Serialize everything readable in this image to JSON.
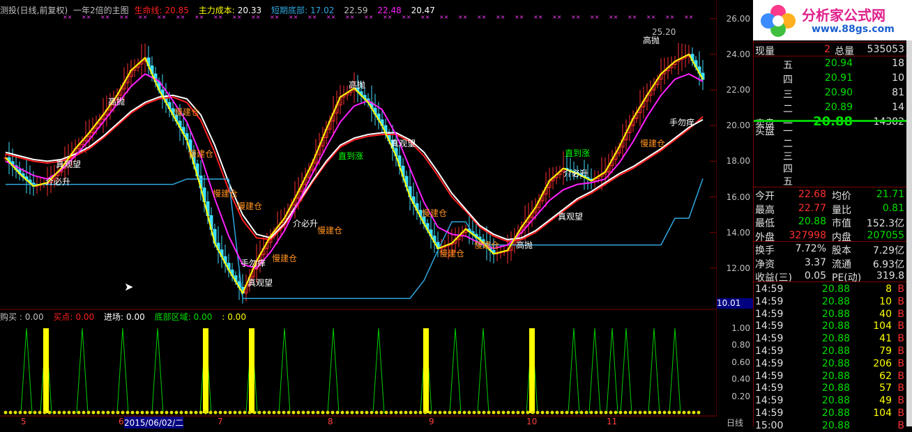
{
  "legend_main": {
    "prefix": "测投(日线,前复权)",
    "indicator": "一年2倍的主图",
    "life_line_label": "生命线:",
    "life_line_value": "20.85",
    "main_cost_label": "主力成本:",
    "main_cost_value": "20.33",
    "short_bottom_label": "短期底部:",
    "short_bottom_value": "17.02",
    "v4": "22.59",
    "v5": "22.48",
    "v6": "20.47"
  },
  "legend_sub": {
    "buy_label": "购买 :",
    "buy_value": "0.00",
    "buy_point_label": "买点:",
    "buy_point_value": "0.00",
    "entry_label": "进场:",
    "entry_value": "0.00",
    "bottom_zone_label": "底部区域:",
    "bottom_zone_value": "0.00",
    "last_label": ":",
    "last_value": "0.00"
  },
  "price_axis": [
    "26.00",
    "24.00",
    "22.00",
    "20.00",
    "18.00",
    "16.00",
    "14.00",
    "12.00"
  ],
  "price_axis_highlight": "10.01",
  "sub_axis": [
    "1.00",
    "0.80",
    "0.60",
    "0.40",
    "0.20"
  ],
  "date_axis": [
    "5",
    "6",
    "2015/06/02/二",
    "7",
    "8",
    "9",
    "10",
    "11"
  ],
  "period_label": "日线",
  "annotations": [
    {
      "text": "高抛",
      "color": "#ffffff"
    },
    {
      "text": "真观望",
      "color": "#ffffff"
    },
    {
      "text": "介必升",
      "color": "#ffffff"
    },
    {
      "text": "慢建仓",
      "color": "#ff9020"
    },
    {
      "text": "慢建仓",
      "color": "#ff9020"
    },
    {
      "text": "慢建仓",
      "color": "#ff9020"
    },
    {
      "text": "慢建仓",
      "color": "#ff9020"
    },
    {
      "text": "手勿痒",
      "color": "#ffffff"
    },
    {
      "text": "真观望",
      "color": "#ffffff"
    },
    {
      "text": "介必升",
      "color": "#ffffff"
    },
    {
      "text": "慢建仓",
      "color": "#ff9020"
    },
    {
      "text": "直到涨",
      "color": "#00ff00"
    },
    {
      "text": "高抛",
      "color": "#ffffff"
    },
    {
      "text": "慢建仓",
      "color": "#ff9020"
    },
    {
      "text": "真观望",
      "color": "#ffffff"
    },
    {
      "text": "慢建仓",
      "color": "#ff9020"
    },
    {
      "text": "慢建仓",
      "color": "#ff9020"
    },
    {
      "text": "慢建仓",
      "color": "#ff9020"
    },
    {
      "text": "高抛",
      "color": "#ffffff"
    },
    {
      "text": "直到涨",
      "color": "#00ff00"
    },
    {
      "text": "介必升",
      "color": "#ffffff"
    },
    {
      "text": "真观望",
      "color": "#ffffff"
    },
    {
      "text": "慢建仓",
      "color": "#ff9020"
    },
    {
      "text": "手勿痒",
      "color": "#ffffff"
    },
    {
      "text": "25.20",
      "color": "#c0c0c0"
    },
    {
      "text": "高抛",
      "color": "#ffffff"
    }
  ],
  "panel": {
    "price_top": "20.8",
    "volume_row": {
      "label": "现量",
      "value": "2",
      "label2": "总量",
      "value2": "535053"
    },
    "asks": [
      {
        "label": "五",
        "price": "20.94",
        "vol": "18"
      },
      {
        "label": "四",
        "price": "20.91",
        "vol": "10"
      },
      {
        "label": "三",
        "price": "20.90",
        "vol": "81"
      },
      {
        "label": "二",
        "price": "20.89",
        "vol": "14"
      },
      {
        "label": "一",
        "price": "20.88",
        "vol": "14382"
      }
    ],
    "ask_title": "卖盘",
    "bid_title": "买盘",
    "bids": [
      "一",
      "二",
      "三",
      "四",
      "五"
    ],
    "stats": [
      {
        "l1": "今开",
        "v1": "22.68",
        "c1": "red",
        "l2": "均价",
        "v2": "21.71",
        "c2": "green"
      },
      {
        "l1": "最高",
        "v1": "22.77",
        "c1": "red",
        "l2": "量比",
        "v2": "0.81",
        "c2": "green"
      },
      {
        "l1": "最低",
        "v1": "20.88",
        "c1": "green",
        "l2": "市值",
        "v2": "152.3亿",
        "c2": "white"
      },
      {
        "l1": "外盘",
        "v1": "327998",
        "c1": "red",
        "l2": "内盘",
        "v2": "207055",
        "c2": "green"
      },
      {
        "l1": "换手",
        "v1": "7.72%",
        "c1": "white",
        "l2": "股本",
        "v2": "7.29亿",
        "c2": "white"
      },
      {
        "l1": "净资",
        "v1": "3.37",
        "c1": "white",
        "l2": "流通",
        "v2": "6.93亿",
        "c2": "white"
      },
      {
        "l1": "收益(三)",
        "v1": "0.05",
        "c1": "white",
        "l2": "PE(动)",
        "v2": "319.8",
        "c2": "white"
      }
    ],
    "ticks": [
      {
        "t": "14:59",
        "p": "20.88",
        "v": "8",
        "s": "B"
      },
      {
        "t": "14:59",
        "p": "20.88",
        "v": "10",
        "s": "B"
      },
      {
        "t": "14:59",
        "p": "20.88",
        "v": "40",
        "s": "B"
      },
      {
        "t": "14:59",
        "p": "20.88",
        "v": "104",
        "s": "B"
      },
      {
        "t": "14:59",
        "p": "20.88",
        "v": "41",
        "s": "B"
      },
      {
        "t": "14:59",
        "p": "20.88",
        "v": "79",
        "s": "B"
      },
      {
        "t": "14:59",
        "p": "20.88",
        "v": "206",
        "s": "B"
      },
      {
        "t": "14:59",
        "p": "20.88",
        "v": "62",
        "s": "B"
      },
      {
        "t": "14:59",
        "p": "20.88",
        "v": "57",
        "s": "B"
      },
      {
        "t": "14:59",
        "p": "20.88",
        "v": "49",
        "s": "B"
      },
      {
        "t": "14:59",
        "p": "20.88",
        "v": "104",
        "s": "B"
      },
      {
        "t": "15:00",
        "p": "20.88",
        "v": "",
        "s": "B"
      }
    ]
  },
  "logo": {
    "title": "分析家公式网",
    "url": "www.88gs.com"
  },
  "chart_data": [
    {
      "type": "line",
      "title": "一年2倍的主图",
      "xlabel": "",
      "ylabel": "",
      "ylim": [
        10,
        26.5
      ],
      "x": [
        0,
        20,
        40,
        60,
        80,
        100,
        120,
        140,
        160,
        180,
        200,
        220,
        240,
        260,
        280,
        300,
        320,
        340,
        360,
        380,
        400,
        420,
        440,
        460,
        480,
        500,
        520,
        540,
        560,
        580,
        600,
        620,
        640,
        660,
        680,
        700,
        720,
        740,
        760,
        780,
        800,
        820,
        840,
        860,
        880,
        900,
        920,
        940,
        960,
        980,
        1000
      ],
      "series": [
        {
          "name": "生命线",
          "color": "#ff2020",
          "values": [
            18.4,
            18.2,
            18.0,
            17.9,
            18.0,
            18.3,
            18.7,
            19.3,
            20.0,
            20.7,
            21.2,
            21.5,
            21.6,
            21.3,
            20.3,
            18.5,
            16.4,
            14.7,
            13.7,
            13.6,
            14.4,
            15.6,
            16.8,
            17.9,
            18.8,
            19.2,
            19.4,
            19.5,
            19.5,
            19.1,
            18.3,
            17.2,
            16.0,
            15.2,
            14.3,
            13.8,
            13.5,
            13.6,
            14.0,
            14.6,
            15.2,
            15.8,
            16.2,
            16.7,
            17.2,
            17.6,
            18.1,
            18.6,
            19.2,
            19.8,
            20.5
          ]
        },
        {
          "name": "主力成本",
          "color": "#ffffff",
          "values": [
            18.5,
            18.3,
            18.1,
            18.0,
            18.1,
            18.4,
            18.8,
            19.4,
            20.1,
            20.8,
            21.3,
            21.6,
            21.7,
            21.5,
            20.6,
            18.9,
            16.8,
            15.0,
            13.9,
            13.7,
            14.5,
            15.7,
            16.9,
            18.0,
            18.9,
            19.3,
            19.5,
            19.6,
            19.6,
            19.2,
            18.5,
            17.4,
            16.2,
            15.3,
            14.4,
            13.9,
            13.6,
            13.7,
            14.1,
            14.7,
            15.3,
            15.9,
            16.3,
            16.8,
            17.3,
            17.7,
            18.2,
            18.7,
            19.3,
            19.9,
            20.33
          ]
        },
        {
          "name": "短期底部",
          "color": "#30a8e0",
          "values": [
            16.7,
            16.7,
            16.7,
            16.7,
            16.7,
            16.7,
            16.7,
            16.7,
            16.7,
            16.7,
            16.7,
            16.7,
            16.7,
            17.0,
            17.0,
            17.0,
            17.0,
            10.3,
            10.3,
            10.3,
            10.3,
            10.3,
            10.3,
            10.3,
            10.3,
            10.3,
            10.3,
            10.3,
            10.3,
            10.3,
            11.3,
            13.0,
            14.6,
            14.6,
            13.3,
            13.3,
            13.3,
            13.3,
            13.3,
            13.3,
            13.3,
            13.3,
            13.3,
            13.3,
            13.3,
            13.3,
            13.3,
            13.3,
            14.8,
            14.8,
            17.02
          ]
        },
        {
          "name": "短线",
          "color": "#ff20ff",
          "values": [
            18.0,
            17.6,
            17.2,
            17.0,
            17.5,
            18.3,
            19.2,
            20.2,
            21.2,
            22.2,
            22.9,
            22.5,
            21.4,
            20.2,
            18.3,
            15.9,
            13.8,
            12.2,
            12.0,
            12.9,
            14.1,
            15.7,
            17.3,
            18.8,
            20.2,
            21.1,
            21.4,
            20.9,
            19.5,
            17.6,
            15.7,
            14.3,
            13.9,
            13.8,
            13.4,
            13.1,
            13.3,
            14.0,
            14.9,
            15.8,
            16.4,
            16.7,
            16.8,
            17.0,
            17.9,
            19.1,
            20.5,
            21.7,
            22.6,
            22.9,
            22.48
          ]
        },
        {
          "name": "价格",
          "color": "#ffff00",
          "values": [
            18.2,
            17.3,
            16.6,
            16.8,
            17.6,
            18.7,
            19.6,
            20.6,
            21.7,
            23.1,
            23.8,
            22.0,
            20.6,
            19.2,
            16.5,
            13.4,
            11.9,
            10.6,
            12.4,
            13.8,
            14.8,
            16.3,
            17.9,
            19.8,
            21.6,
            22.1,
            21.3,
            20.0,
            18.3,
            16.0,
            14.5,
            13.1,
            13.4,
            14.2,
            13.6,
            12.8,
            13.0,
            14.3,
            15.4,
            16.9,
            17.6,
            17.3,
            16.9,
            17.4,
            18.8,
            20.4,
            21.7,
            22.9,
            23.6,
            24.0,
            22.59
          ]
        }
      ]
    },
    {
      "type": "bar",
      "title": "",
      "xlabel": "",
      "ylabel": "",
      "ylim": [
        0,
        1.05
      ],
      "yellow_signals_x": [
        58,
        287,
        353,
        603,
        755
      ],
      "green_peaks_x": [
        30,
        58,
        110,
        168,
        218,
        287,
        353,
        400,
        470,
        535,
        603,
        645,
        685,
        755,
        815,
        845,
        870,
        890,
        930,
        960
      ]
    }
  ]
}
